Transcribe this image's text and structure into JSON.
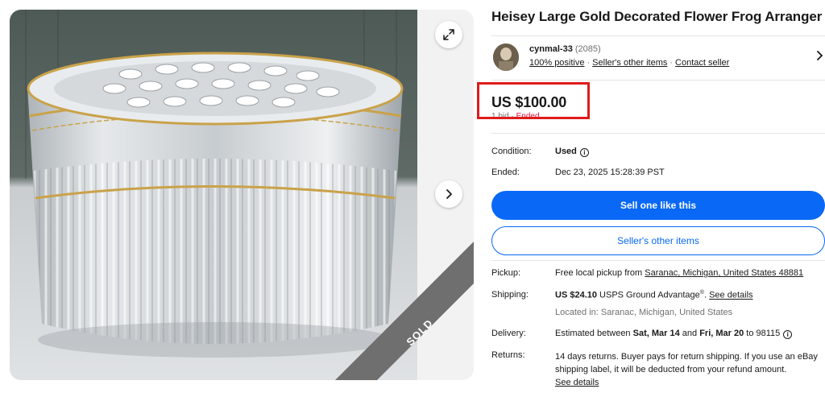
{
  "gallery": {
    "sold_label": "SOLD",
    "expand_icon": "expand-icon",
    "next_icon": "chevron-right-icon"
  },
  "listing": {
    "title": "Heisey Large Gold Decorated Flower Frog Arranger"
  },
  "seller": {
    "name": "cynmal-33",
    "score": "(2085)",
    "feedback": "100% positive",
    "other_items_link": "Seller's other items",
    "contact_link": "Contact seller"
  },
  "price": {
    "amount": "US $100.00",
    "bids": "1 bid",
    "separator": "·",
    "status": "Ended"
  },
  "details": {
    "condition_label": "Condition:",
    "condition_value": "Used",
    "ended_label": "Ended:",
    "ended_value": "Dec 23, 2025 15:28:39 PST"
  },
  "actions": {
    "sell_like_this": "Sell one like this",
    "sellers_other_items": "Seller's other items"
  },
  "shipping": {
    "pickup_label": "Pickup:",
    "pickup_text": "Free local pickup from ",
    "pickup_location": "Saranac, Michigan, United States 48881",
    "shipping_label": "Shipping:",
    "shipping_price": "US $24.10",
    "shipping_service": " USPS Ground Advantage",
    "shipping_reg": "®",
    "shipping_sep": ". ",
    "see_details": "See details",
    "located_in": "Located in: Saranac, Michigan, United States",
    "delivery_label": "Delivery:",
    "delivery_prefix": "Estimated between ",
    "delivery_start": "Sat, Mar 14",
    "delivery_and": " and ",
    "delivery_end": "Fri, Mar 20",
    "delivery_zip": " to 98115",
    "returns_label": "Returns:",
    "returns_text": "14 days returns. Buyer pays for return shipping. If you use an eBay shipping label, it will be deducted from your refund amount.",
    "returns_link": "See details"
  },
  "colors": {
    "primary_blue": "#0968f6",
    "highlight_red": "#e01b1b",
    "ended_red": "#e0103a",
    "sold_ribbon": "#6f6f6f"
  }
}
